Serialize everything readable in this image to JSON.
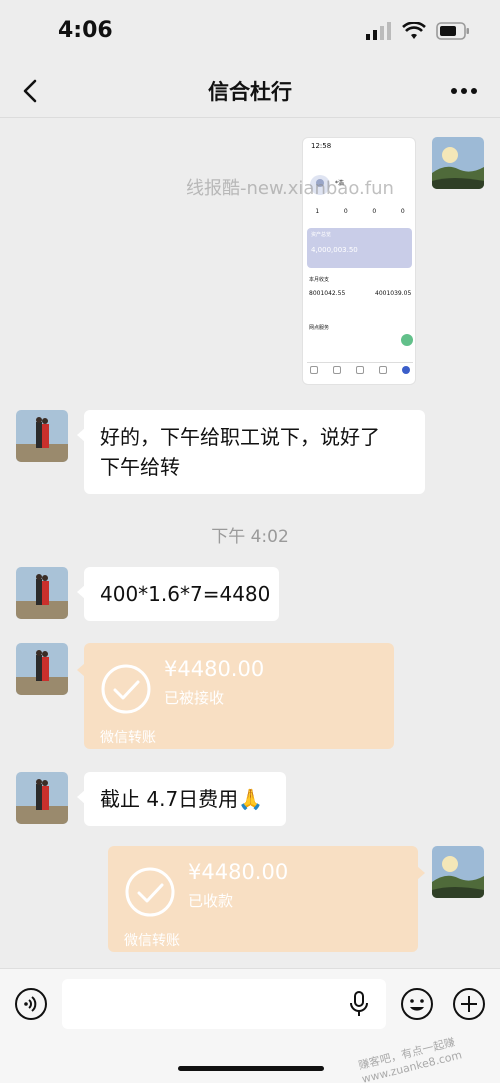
{
  "status": {
    "time": "4:06"
  },
  "nav": {
    "title": "信合杜行"
  },
  "watermark": "线报酷-new.xianbao.fun",
  "screenshot": {
    "time": "12:58",
    "name": "*浩",
    "stats": [
      "1",
      "0",
      "0",
      "0"
    ],
    "asset_label": "资产总览",
    "asset_value": "4,000,003.50",
    "month_label": "本月收支",
    "income": "8001042.55",
    "expense": "4001039.05",
    "service_label": "网点服务"
  },
  "messages": [
    {
      "type": "text",
      "side": "left",
      "text_line1": "好的，下午给职工说下，说好了",
      "text_line2": "下午给转"
    },
    {
      "type": "time",
      "text": "下午 4:02"
    },
    {
      "type": "text",
      "side": "left",
      "text": "400*1.6*7=4480"
    },
    {
      "type": "transfer",
      "side": "left",
      "amount": "¥4480.00",
      "status": "已被接收",
      "label": "微信转账"
    },
    {
      "type": "text",
      "side": "left",
      "text": "截止 4.7日费用🙏"
    },
    {
      "type": "transfer",
      "side": "right",
      "amount": "¥4480.00",
      "status": "已收款",
      "label": "微信转账"
    }
  ],
  "footer_mark": "赚客吧，有点一起赚 www.zuanke8.com",
  "icons": {
    "back": "chevron-left-icon",
    "more": "more-icon",
    "voice": "voice-icon",
    "mic": "microphone-icon",
    "emoji": "emoji-icon",
    "plus": "plus-icon",
    "check": "check-circle-icon"
  },
  "colors": {
    "background": "#ededed",
    "bubble": "#ffffff",
    "transfer_bg": "#f8dfc3",
    "text": "#111111"
  }
}
